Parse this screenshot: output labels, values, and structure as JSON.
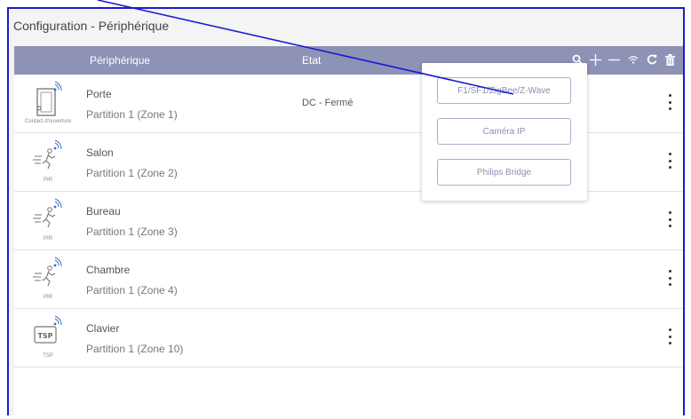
{
  "page": {
    "title": "Configuration - Périphérique"
  },
  "table": {
    "columns": {
      "device": "Périphérique",
      "state": "Etat"
    },
    "toolbar_icons": [
      "search-icon",
      "plus-icon",
      "minus-icon",
      "wifi-icon",
      "refresh-icon",
      "trash-icon"
    ],
    "rows": [
      {
        "caption": "Contact d'ouverture",
        "name": "Porte",
        "zone": "Partition 1 (Zone 1)",
        "state": "DC - Fermé",
        "icon": "door-contact-icon"
      },
      {
        "caption": "PIR",
        "name": "Salon",
        "zone": "Partition 1 (Zone 2)",
        "state": "",
        "icon": "motion-sensor-icon"
      },
      {
        "caption": "PIR",
        "name": "Bureau",
        "zone": "Partition 1 (Zone 3)",
        "state": "",
        "icon": "motion-sensor-icon"
      },
      {
        "caption": "PIR",
        "name": "Chambre",
        "zone": "Partition 1 (Zone 4)",
        "state": "",
        "icon": "motion-sensor-icon"
      },
      {
        "caption": "TSP",
        "name": "Clavier",
        "zone": "Partition 1 (Zone 10)",
        "state": "",
        "icon": "keypad-icon"
      }
    ]
  },
  "add_menu": {
    "options": [
      "F1/SF1/ZigBee/Z-Wave",
      "Caméra IP",
      "Philips Bridge"
    ]
  },
  "colors": {
    "header": "#8e93b5",
    "annotation": "#1c1ccf"
  }
}
